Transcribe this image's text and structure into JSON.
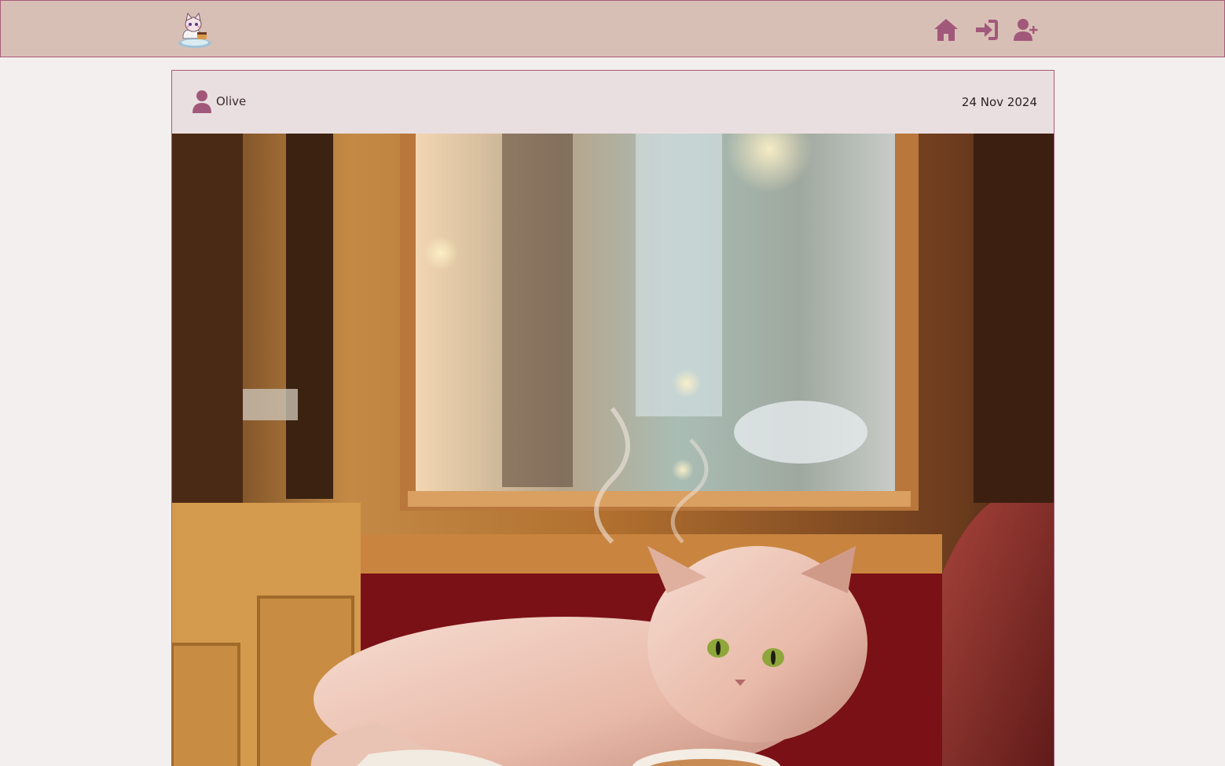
{
  "navbar": {
    "logo_icon": "cat-cafe-logo-icon",
    "home_icon": "home-icon",
    "login_icon": "sign-in-icon",
    "register_icon": "user-plus-icon",
    "accent_color": "#a85b78",
    "background_color": "#d8bfb5"
  },
  "post": {
    "author": "Olive",
    "author_icon": "user-icon",
    "date": "24 Nov 2024",
    "image_subject": "cat-by-rainy-window-image"
  },
  "colors": {
    "page_background": "#f4efef",
    "card_background": "#eadfe0"
  }
}
